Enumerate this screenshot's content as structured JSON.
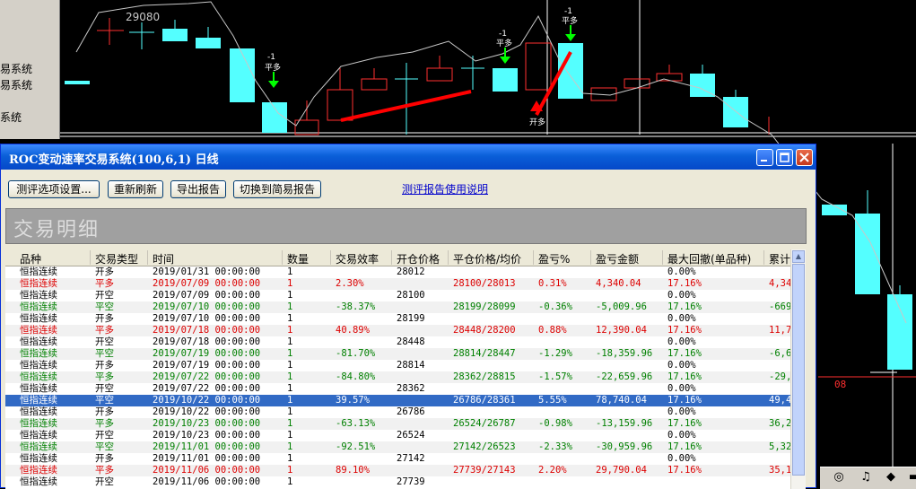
{
  "left_panel": {
    "lines": [
      "易系统",
      "易系统",
      "系统"
    ]
  },
  "chart": {
    "annotations": {
      "price_label": "29080",
      "signal_1": {
        "count": "-1",
        "label": "平多"
      },
      "signal_2": {
        "count": "-1",
        "label": "平多"
      },
      "signal_3": {
        "count": "-1",
        "label": "平多"
      },
      "signal_4": {
        "label": "开多"
      },
      "date_label": "08"
    },
    "up_color": "#ff3030",
    "down_color": "#54ffff",
    "signal_color": "#00ff00",
    "trade_line_color": "#ff0000"
  },
  "window": {
    "title": "ROC变动速率交易系统(100,6,1) 日线",
    "buttons": {
      "settings": "测评选项设置...",
      "refresh": "重新刷新",
      "export": "导出报告",
      "switch": "切换到简易报告"
    },
    "help_link": "测评报告使用说明",
    "section_title": "交易明细",
    "columns": [
      "品种",
      "交易类型",
      "时间",
      "数量",
      "交易效率",
      "开仓价格",
      "平仓价格/均价",
      "盈亏%",
      "盈亏金额",
      "最大回撤(单品种)",
      "累计"
    ],
    "rows": [
      {
        "instrument": "恒指连续",
        "type": "开多",
        "time": "2019/01/31 00:00:00",
        "qty": "1",
        "eff": "",
        "open": "28012",
        "close": "",
        "pct": "",
        "amount": "",
        "dd": "0.00%",
        "cum": "",
        "color": "black"
      },
      {
        "instrument": "恒指连续",
        "type": "平多",
        "time": "2019/07/09 00:00:00",
        "qty": "1",
        "eff": "2.30%",
        "open": "",
        "close": "28100/28013",
        "pct": "0.31%",
        "amount": "4,340.04",
        "dd": "17.16%",
        "cum": "4,34",
        "color": "red"
      },
      {
        "instrument": "恒指连续",
        "type": "开空",
        "time": "2019/07/09 00:00:00",
        "qty": "1",
        "eff": "",
        "open": "28100",
        "close": "",
        "pct": "",
        "amount": "",
        "dd": "0.00%",
        "cum": "",
        "color": "black"
      },
      {
        "instrument": "恒指连续",
        "type": "平空",
        "time": "2019/07/10 00:00:00",
        "qty": "1",
        "eff": "-38.37%",
        "open": "",
        "close": "28199/28099",
        "pct": "-0.36%",
        "amount": "-5,009.96",
        "dd": "17.16%",
        "cum": "-669",
        "color": "green"
      },
      {
        "instrument": "恒指连续",
        "type": "开多",
        "time": "2019/07/10 00:00:00",
        "qty": "1",
        "eff": "",
        "open": "28199",
        "close": "",
        "pct": "",
        "amount": "",
        "dd": "0.00%",
        "cum": "",
        "color": "black"
      },
      {
        "instrument": "恒指连续",
        "type": "平多",
        "time": "2019/07/18 00:00:00",
        "qty": "1",
        "eff": "40.89%",
        "open": "",
        "close": "28448/28200",
        "pct": "0.88%",
        "amount": "12,390.04",
        "dd": "17.16%",
        "cum": "11,7",
        "color": "red"
      },
      {
        "instrument": "恒指连续",
        "type": "开空",
        "time": "2019/07/18 00:00:00",
        "qty": "1",
        "eff": "",
        "open": "28448",
        "close": "",
        "pct": "",
        "amount": "",
        "dd": "0.00%",
        "cum": "",
        "color": "black"
      },
      {
        "instrument": "恒指连续",
        "type": "平空",
        "time": "2019/07/19 00:00:00",
        "qty": "1",
        "eff": "-81.70%",
        "open": "",
        "close": "28814/28447",
        "pct": "-1.29%",
        "amount": "-18,359.96",
        "dd": "17.16%",
        "cum": "-6,6",
        "color": "green"
      },
      {
        "instrument": "恒指连续",
        "type": "开多",
        "time": "2019/07/19 00:00:00",
        "qty": "1",
        "eff": "",
        "open": "28814",
        "close": "",
        "pct": "",
        "amount": "",
        "dd": "0.00%",
        "cum": "",
        "color": "black"
      },
      {
        "instrument": "恒指连续",
        "type": "平多",
        "time": "2019/07/22 00:00:00",
        "qty": "1",
        "eff": "-84.80%",
        "open": "",
        "close": "28362/28815",
        "pct": "-1.57%",
        "amount": "-22,659.96",
        "dd": "17.16%",
        "cum": "-29,",
        "color": "green"
      },
      {
        "instrument": "恒指连续",
        "type": "开空",
        "time": "2019/07/22 00:00:00",
        "qty": "1",
        "eff": "",
        "open": "28362",
        "close": "",
        "pct": "",
        "amount": "",
        "dd": "0.00%",
        "cum": "",
        "color": "black"
      },
      {
        "instrument": "恒指连续",
        "type": "平空",
        "time": "2019/10/22 00:00:00",
        "qty": "1",
        "eff": "39.57%",
        "open": "",
        "close": "26786/28361",
        "pct": "5.55%",
        "amount": "78,740.04",
        "dd": "17.16%",
        "cum": "49,4",
        "color": "selected"
      },
      {
        "instrument": "恒指连续",
        "type": "开多",
        "time": "2019/10/22 00:00:00",
        "qty": "1",
        "eff": "",
        "open": "26786",
        "close": "",
        "pct": "",
        "amount": "",
        "dd": "0.00%",
        "cum": "",
        "color": "black"
      },
      {
        "instrument": "恒指连续",
        "type": "平多",
        "time": "2019/10/23 00:00:00",
        "qty": "1",
        "eff": "-63.13%",
        "open": "",
        "close": "26524/26787",
        "pct": "-0.98%",
        "amount": "-13,159.96",
        "dd": "17.16%",
        "cum": "36,2",
        "color": "green"
      },
      {
        "instrument": "恒指连续",
        "type": "开空",
        "time": "2019/10/23 00:00:00",
        "qty": "1",
        "eff": "",
        "open": "26524",
        "close": "",
        "pct": "",
        "amount": "",
        "dd": "0.00%",
        "cum": "",
        "color": "black"
      },
      {
        "instrument": "恒指连续",
        "type": "平空",
        "time": "2019/11/01 00:00:00",
        "qty": "1",
        "eff": "-92.51%",
        "open": "",
        "close": "27142/26523",
        "pct": "-2.33%",
        "amount": "-30,959.96",
        "dd": "17.16%",
        "cum": "5,32",
        "color": "green"
      },
      {
        "instrument": "恒指连续",
        "type": "开多",
        "time": "2019/11/01 00:00:00",
        "qty": "1",
        "eff": "",
        "open": "27142",
        "close": "",
        "pct": "",
        "amount": "",
        "dd": "0.00%",
        "cum": "",
        "color": "black"
      },
      {
        "instrument": "恒指连续",
        "type": "平多",
        "time": "2019/11/06 00:00:00",
        "qty": "1",
        "eff": "89.10%",
        "open": "",
        "close": "27739/27143",
        "pct": "2.20%",
        "amount": "29,790.04",
        "dd": "17.16%",
        "cum": "35,1",
        "color": "red"
      },
      {
        "instrument": "恒指连续",
        "type": "开空",
        "time": "2019/11/06 00:00:00",
        "qty": "1",
        "eff": "",
        "open": "27739",
        "close": "",
        "pct": "",
        "amount": "",
        "dd": "",
        "cum": "",
        "color": "black"
      }
    ]
  },
  "status_tray": {
    "icons": [
      "help-icon",
      "bell-icon",
      "tag-icon",
      "folder-icon"
    ]
  }
}
